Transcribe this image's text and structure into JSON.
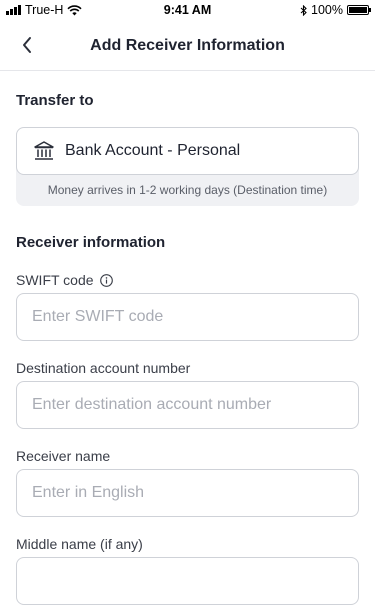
{
  "status_bar": {
    "carrier": "True-H",
    "time": "9:41 AM",
    "battery": "100%",
    "battery_level": 1.0
  },
  "header": {
    "title": "Add Receiver Information",
    "back_icon": "chevron-left-icon"
  },
  "transfer": {
    "section_title": "Transfer to",
    "method_label": "Bank Account - Personal",
    "method_icon": "bank-icon",
    "note": "Money arrives in 1-2 working days (Destination time)"
  },
  "receiver": {
    "section_title": "Receiver information",
    "fields": [
      {
        "label": "SWIFT code",
        "placeholder": "Enter SWIFT code",
        "value": "",
        "has_info_icon": true
      },
      {
        "label": "Destination account number",
        "placeholder": "Enter destination account number",
        "value": ""
      },
      {
        "label": "Receiver name",
        "placeholder": "Enter in English",
        "value": ""
      },
      {
        "label": "Middle name (if any)",
        "placeholder": "",
        "value": ""
      }
    ]
  },
  "colors": {
    "text_primary": "#1f2330",
    "border": "#cfd2d8",
    "note_background": "#f0f1f4",
    "placeholder": "#a9acb4"
  }
}
